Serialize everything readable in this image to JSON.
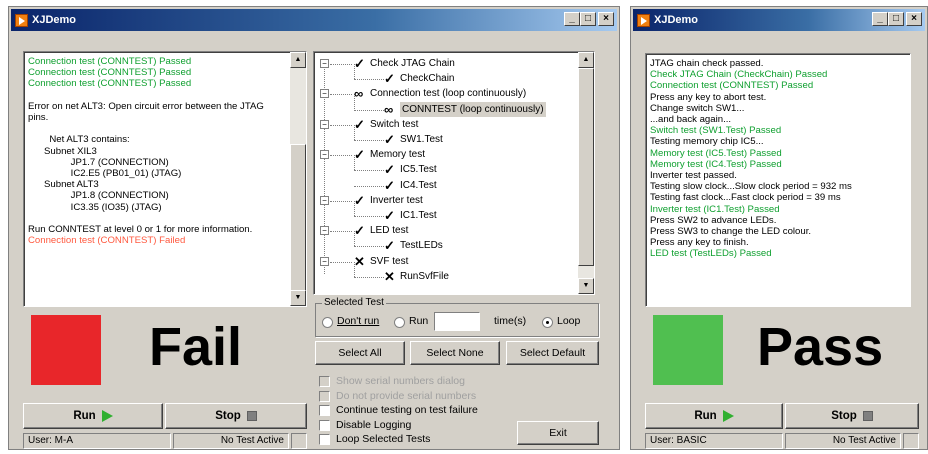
{
  "left_window": {
    "title": "XJDemo",
    "log_lines": [
      {
        "text": "Connection test (CONNTEST) Passed",
        "color": "green"
      },
      {
        "text": "Connection test (CONNTEST) Passed",
        "color": "green"
      },
      {
        "text": "Connection test (CONNTEST) Passed",
        "color": "green"
      },
      {
        "text": "",
        "color": "black"
      },
      {
        "text": "Error on net ALT3: Open circuit error between the JTAG",
        "color": "black"
      },
      {
        "text": "pins.",
        "color": "black"
      },
      {
        "text": "",
        "color": "black"
      },
      {
        "text": "        Net ALT3 contains:",
        "color": "black"
      },
      {
        "text": "      Subnet XIL3",
        "color": "black"
      },
      {
        "text": "                JP1.7 (CONNECTION)",
        "color": "black"
      },
      {
        "text": "                IC2.E5 (PB01_01) (JTAG)",
        "color": "black"
      },
      {
        "text": "      Subnet ALT3",
        "color": "black"
      },
      {
        "text": "                JP1.8 (CONNECTION)",
        "color": "black"
      },
      {
        "text": "                IC3.35 (IO35) (JTAG)",
        "color": "black"
      },
      {
        "text": "",
        "color": "black"
      },
      {
        "text": "Run CONNTEST at level 0 or 1 for more information.",
        "color": "black"
      },
      {
        "text": "Connection test (CONNTEST) Failed",
        "color": "red"
      }
    ],
    "result_word": "Fail",
    "result_color": "#e8262a",
    "run_label": "Run",
    "stop_label": "Stop",
    "status_user": "User: M-A",
    "status_state": "No Test Active",
    "tree": [
      {
        "level": 0,
        "mark": "check",
        "label": "Check JTAG Chain",
        "expander": "−"
      },
      {
        "level": 1,
        "mark": "check",
        "label": "CheckChain"
      },
      {
        "level": 0,
        "mark": "loop",
        "label": "Connection test (loop continuously)",
        "expander": "−"
      },
      {
        "level": 1,
        "mark": "loop",
        "label": "CONNTEST (loop continuously)",
        "selected": true
      },
      {
        "level": 0,
        "mark": "check",
        "label": "Switch test",
        "expander": "−"
      },
      {
        "level": 1,
        "mark": "check",
        "label": "SW1.Test"
      },
      {
        "level": 0,
        "mark": "check",
        "label": "Memory test",
        "expander": "−"
      },
      {
        "level": 1,
        "mark": "check",
        "label": "IC5.Test"
      },
      {
        "level": 1,
        "mark": "check",
        "label": "IC4.Test"
      },
      {
        "level": 0,
        "mark": "check",
        "label": "Inverter test",
        "expander": "−"
      },
      {
        "level": 1,
        "mark": "check",
        "label": "IC1.Test"
      },
      {
        "level": 0,
        "mark": "check",
        "label": "LED test",
        "expander": "−"
      },
      {
        "level": 1,
        "mark": "check",
        "label": "TestLEDs"
      },
      {
        "level": 0,
        "mark": "cross",
        "label": "SVF test",
        "expander": "−"
      },
      {
        "level": 1,
        "mark": "cross",
        "label": "RunSvfFile"
      }
    ],
    "selected_test": {
      "legend": "Selected Test",
      "dont_run": "Don't run",
      "run": "Run",
      "times": "time(s)",
      "loop": "Loop",
      "selected": "loop"
    },
    "select_all": "Select All",
    "select_none": "Select None",
    "select_default": "Select Default",
    "options": [
      {
        "label": "Show serial numbers dialog",
        "disabled": true
      },
      {
        "label": "Do not provide serial numbers",
        "disabled": true
      },
      {
        "label": "Continue testing on test failure",
        "disabled": false
      },
      {
        "label": "Disable Logging",
        "disabled": false
      },
      {
        "label": "Loop Selected Tests",
        "disabled": false
      }
    ],
    "exit_label": "Exit"
  },
  "right_window": {
    "title": "XJDemo",
    "log_lines": [
      {
        "text": "JTAG chain check passed.",
        "color": "black"
      },
      {
        "text": "Check JTAG Chain (CheckChain) Passed",
        "color": "green"
      },
      {
        "text": "Connection test (CONNTEST) Passed",
        "color": "green"
      },
      {
        "text": "Press any key to abort test.",
        "color": "black"
      },
      {
        "text": "Change switch SW1...",
        "color": "black"
      },
      {
        "text": "...and back again...",
        "color": "black"
      },
      {
        "text": "Switch test (SW1.Test) Passed",
        "color": "green"
      },
      {
        "text": "Testing memory chip IC5...",
        "color": "black"
      },
      {
        "text": "Memory test (IC5.Test) Passed",
        "color": "green"
      },
      {
        "text": "Memory test (IC4.Test) Passed",
        "color": "green"
      },
      {
        "text": "Inverter test passed.",
        "color": "black"
      },
      {
        "text": "Testing slow clock...Slow clock period = 932 ms",
        "color": "black"
      },
      {
        "text": "Testing fast clock...Fast clock period = 39 ms",
        "color": "black"
      },
      {
        "text": "Inverter test (IC1.Test) Passed",
        "color": "green"
      },
      {
        "text": "Press SW2 to advance LEDs.",
        "color": "black"
      },
      {
        "text": "Press SW3 to change the LED colour.",
        "color": "black"
      },
      {
        "text": "Press any key to finish.",
        "color": "black"
      },
      {
        "text": "LED test (TestLEDs) Passed",
        "color": "green"
      }
    ],
    "result_word": "Pass",
    "result_color": "#50bf50",
    "run_label": "Run",
    "stop_label": "Stop",
    "status_user": "User: BASIC",
    "status_state": "No Test Active"
  }
}
